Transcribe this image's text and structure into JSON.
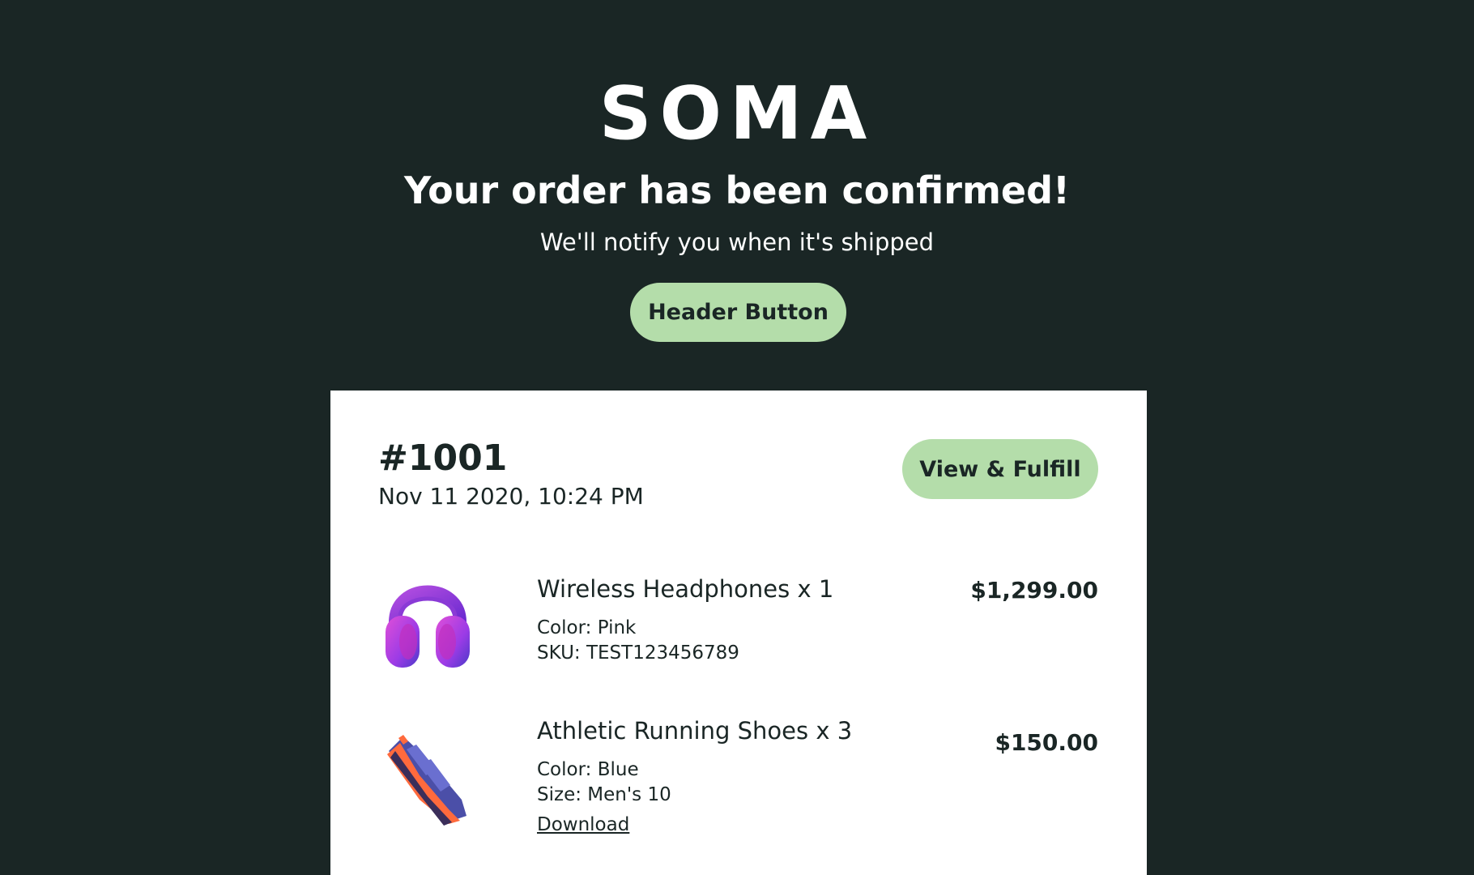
{
  "brand": {
    "name": "SOMA"
  },
  "header": {
    "title": "Your order has been confirmed!",
    "subtitle": "We'll notify you when it's shipped",
    "button_label": "Header Button"
  },
  "order": {
    "number": "#1001",
    "date": "Nov 11 2020, 10:24 PM",
    "action_label": "View & Fulfill",
    "items": [
      {
        "name": "Wireless Headphones x 1",
        "details": [
          "Color: Pink",
          "SKU: TEST123456789"
        ],
        "price": "$1,299.00",
        "image": "headphones"
      },
      {
        "name": "Athletic Running Shoes x 3",
        "details": [
          "Color: Blue",
          "Size: Men's 10"
        ],
        "link_label": "Download",
        "price": "$150.00",
        "image": "running-shoe"
      }
    ]
  },
  "colors": {
    "background": "#1a2625",
    "accent": "#b4ddaa",
    "card": "#ffffff",
    "text_dark": "#1a2625"
  }
}
